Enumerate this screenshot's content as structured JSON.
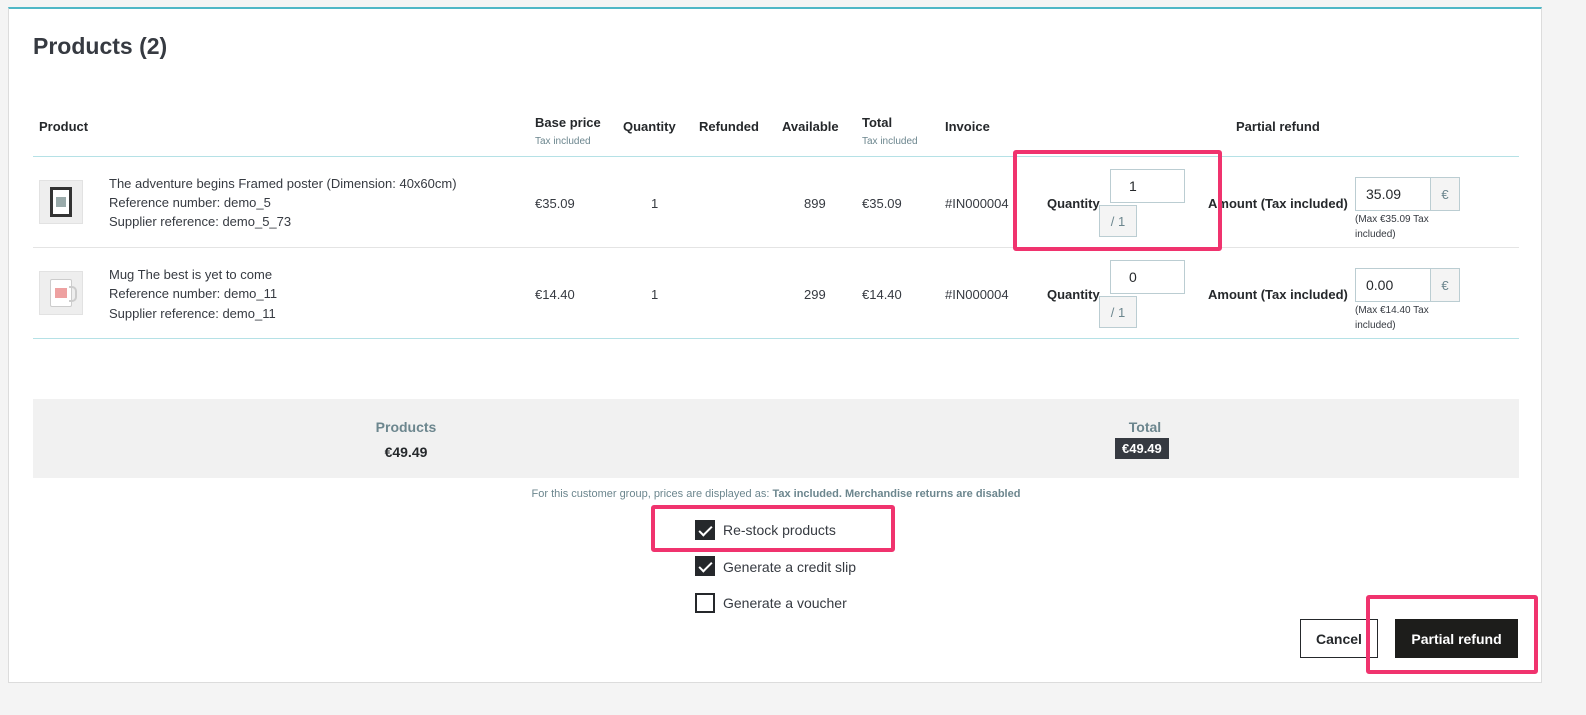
{
  "title": "Products (2)",
  "columns": {
    "product": "Product",
    "base_price": "Base price",
    "base_price_sub": "Tax included",
    "quantity": "Quantity",
    "refunded": "Refunded",
    "available": "Available",
    "total": "Total",
    "total_sub": "Tax included",
    "invoice": "Invoice",
    "partial_refund": "Partial refund"
  },
  "rows": [
    {
      "name": "The adventure begins Framed poster (Dimension: 40x60cm)",
      "reference": "Reference number: demo_5",
      "supplier": "Supplier reference: demo_5_73",
      "base_price": "€35.09",
      "quantity": "1",
      "refunded": "",
      "available": "899",
      "total": "€35.09",
      "invoice": "#IN000004",
      "qty_label": "Quantity",
      "qty_value": "1",
      "qty_max": "/ 1",
      "amount_label": "Amount (Tax included)",
      "amount_value": "35.09",
      "currency": "€",
      "amount_max": "(Max €35.09 Tax included)"
    },
    {
      "name": "Mug The best is yet to come",
      "reference": "Reference number: demo_11",
      "supplier": "Supplier reference: demo_11",
      "base_price": "€14.40",
      "quantity": "1",
      "refunded": "",
      "available": "299",
      "total": "€14.40",
      "invoice": "#IN000004",
      "qty_label": "Quantity",
      "qty_value": "0",
      "qty_max": "/ 1",
      "amount_label": "Amount (Tax included)",
      "amount_value": "0.00",
      "currency": "€",
      "amount_max": "(Max €14.40 Tax included)"
    }
  ],
  "summary": {
    "products_label": "Products",
    "products_value": "€49.49",
    "total_label": "Total",
    "total_value": "€49.49"
  },
  "note": {
    "prefix": "For this customer group, prices are displayed as:",
    "tax_mode": "Tax included",
    "returns": "Merchandise returns are disabled"
  },
  "options": [
    {
      "label": "Re-stock products",
      "checked": true
    },
    {
      "label": "Generate a credit slip",
      "checked": true
    },
    {
      "label": "Generate a voucher",
      "checked": false
    }
  ],
  "buttons": {
    "cancel": "Cancel",
    "partial_refund": "Partial refund"
  },
  "colors": {
    "highlight": "#f0336e",
    "accent_line": "#4fb7c6",
    "primary_button": "#1d1d1b"
  }
}
